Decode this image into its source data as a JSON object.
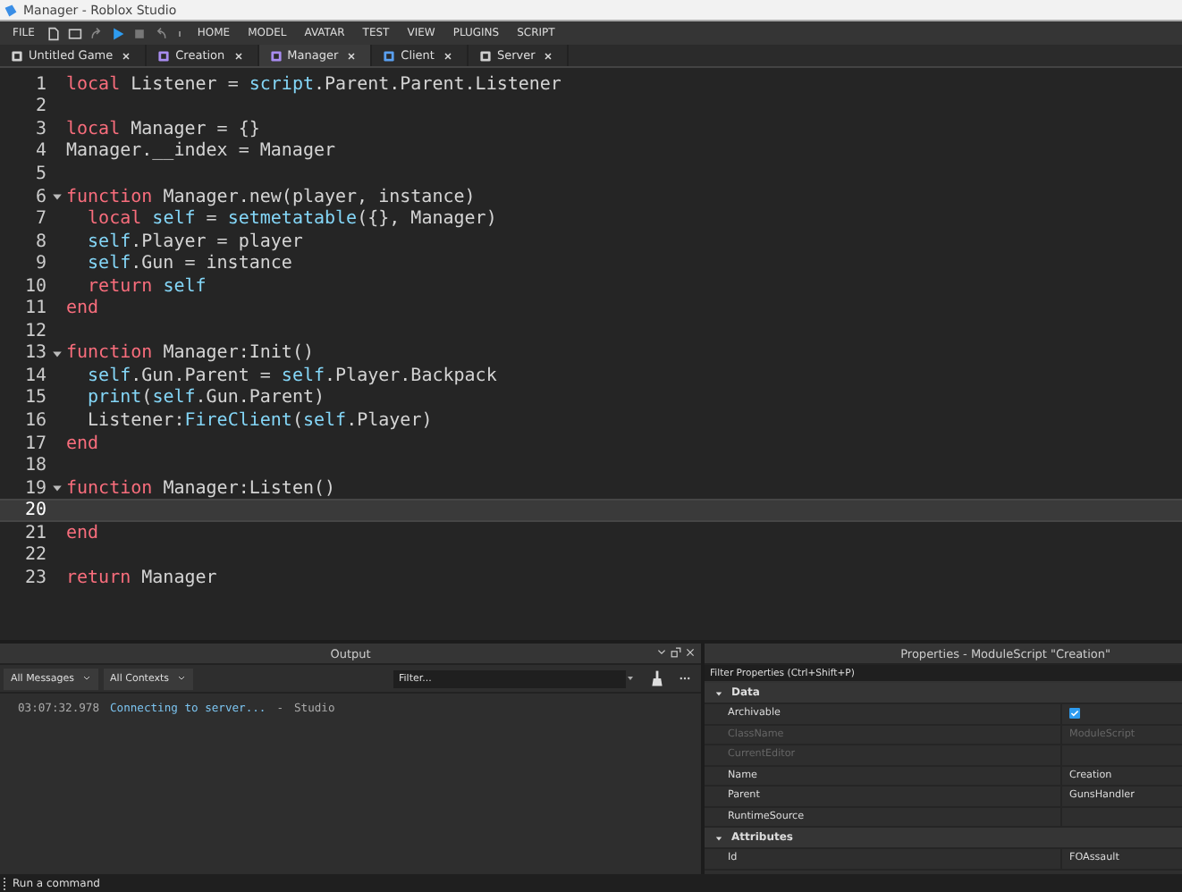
{
  "window": {
    "title": "Manager - Roblox Studio"
  },
  "menu": {
    "file": "FILE",
    "items": [
      "HOME",
      "MODEL",
      "AVATAR",
      "TEST",
      "VIEW",
      "PLUGINS",
      "SCRIPT"
    ]
  },
  "tabs": [
    {
      "label": "Untitled Game",
      "selected": false,
      "kind": "place"
    },
    {
      "label": "Creation",
      "selected": false,
      "kind": "module"
    },
    {
      "label": "Manager",
      "selected": true,
      "kind": "module"
    },
    {
      "label": "Client",
      "selected": false,
      "kind": "local"
    },
    {
      "label": "Server",
      "selected": false,
      "kind": "server"
    }
  ],
  "editor": {
    "lines": [
      {
        "number": "1",
        "foldable": false,
        "selected": false,
        "tokens": [
          {
            "text": "local",
            "kind": "keyword"
          },
          {
            "text": " Listener = ",
            "kind": "plain"
          },
          {
            "text": "script",
            "kind": "builtin"
          },
          {
            "text": ".Parent.Parent.Listener",
            "kind": "plain"
          }
        ]
      },
      {
        "number": "2",
        "foldable": false,
        "selected": false
      },
      {
        "number": "3",
        "foldable": false,
        "selected": false,
        "tokens": [
          {
            "text": "local",
            "kind": "keyword"
          },
          {
            "text": " Manager = {}",
            "kind": "plain"
          }
        ]
      },
      {
        "number": "4",
        "foldable": false,
        "selected": false,
        "tokens": [
          {
            "text": "Manager.__index = Manager",
            "kind": "plain"
          }
        ]
      },
      {
        "number": "5",
        "foldable": false,
        "selected": false
      },
      {
        "number": "6",
        "foldable": true,
        "selected": false,
        "tokens": [
          {
            "text": "function",
            "kind": "keyword"
          },
          {
            "text": " Manager.new(player, instance)",
            "kind": "plain"
          }
        ]
      },
      {
        "number": "7",
        "foldable": false,
        "selected": false,
        "tokens": [
          {
            "text": "  local",
            "kind": "keyword"
          },
          {
            "text": " self",
            "kind": "builtin"
          },
          {
            "text": " = ",
            "kind": "plain"
          },
          {
            "text": "setmetatable",
            "kind": "builtin"
          },
          {
            "text": "({}, Manager)",
            "kind": "plain"
          }
        ]
      },
      {
        "number": "8",
        "foldable": false,
        "selected": false,
        "tokens": [
          {
            "text": "  self",
            "kind": "builtin"
          },
          {
            "text": ".Player = player",
            "kind": "plain"
          }
        ]
      },
      {
        "number": "9",
        "foldable": false,
        "selected": false,
        "tokens": [
          {
            "text": "  self",
            "kind": "builtin"
          },
          {
            "text": ".Gun = instance",
            "kind": "plain"
          }
        ]
      },
      {
        "number": "10",
        "foldable": false,
        "selected": false,
        "tokens": [
          {
            "text": "  return",
            "kind": "keyword"
          },
          {
            "text": " self",
            "kind": "builtin"
          }
        ]
      },
      {
        "number": "11",
        "foldable": false,
        "selected": false,
        "tokens": [
          {
            "text": "end",
            "kind": "keyword"
          }
        ]
      },
      {
        "number": "12",
        "foldable": false,
        "selected": false
      },
      {
        "number": "13",
        "foldable": true,
        "selected": false,
        "tokens": [
          {
            "text": "function",
            "kind": "keyword"
          },
          {
            "text": " Manager:Init()",
            "kind": "plain"
          }
        ]
      },
      {
        "number": "14",
        "foldable": false,
        "selected": false,
        "tokens": [
          {
            "text": "  self",
            "kind": "builtin"
          },
          {
            "text": ".Gun.Parent = ",
            "kind": "plain"
          },
          {
            "text": "self",
            "kind": "builtin"
          },
          {
            "text": ".Player.Backpack",
            "kind": "plain"
          }
        ]
      },
      {
        "number": "15",
        "foldable": false,
        "selected": false,
        "tokens": [
          {
            "text": "  print",
            "kind": "builtin"
          },
          {
            "text": "(",
            "kind": "plain"
          },
          {
            "text": "self",
            "kind": "builtin"
          },
          {
            "text": ".Gun.Parent)",
            "kind": "plain"
          }
        ]
      },
      {
        "number": "16",
        "foldable": false,
        "selected": false,
        "tokens": [
          {
            "text": "  Listener:",
            "kind": "plain"
          },
          {
            "text": "FireClient",
            "kind": "builtin"
          },
          {
            "text": "(",
            "kind": "plain"
          },
          {
            "text": "self",
            "kind": "builtin"
          },
          {
            "text": ".Player)",
            "kind": "plain"
          }
        ]
      },
      {
        "number": "17",
        "foldable": false,
        "selected": false,
        "tokens": [
          {
            "text": "end",
            "kind": "keyword"
          }
        ]
      },
      {
        "number": "18",
        "foldable": false,
        "selected": false
      },
      {
        "number": "19",
        "foldable": true,
        "selected": false,
        "tokens": [
          {
            "text": "function",
            "kind": "keyword"
          },
          {
            "text": " Manager:Listen()",
            "kind": "plain"
          }
        ]
      },
      {
        "number": "20",
        "foldable": false,
        "selected": true
      },
      {
        "number": "21",
        "foldable": false,
        "selected": false,
        "tokens": [
          {
            "text": "end",
            "kind": "keyword"
          }
        ]
      },
      {
        "number": "22",
        "foldable": false,
        "selected": false
      },
      {
        "number": "23",
        "foldable": false,
        "selected": false,
        "tokens": [
          {
            "text": "return",
            "kind": "keyword"
          },
          {
            "text": " Manager",
            "kind": "plain"
          }
        ]
      }
    ]
  },
  "output": {
    "title": "Output",
    "filters": [
      "All Messages",
      "All Contexts"
    ],
    "search": {
      "placeholder": "Filter..."
    },
    "entries": [
      {
        "time": "03:07:32.978",
        "message": "Connecting to server...",
        "separator": "-",
        "source": "Studio"
      }
    ]
  },
  "properties": {
    "title": "Properties - ModuleScript \"Creation\"",
    "search": {
      "placeholder": "Filter Properties (Ctrl+Shift+P)"
    },
    "sections": [
      {
        "name": "Data",
        "expanded": true,
        "rows": [
          {
            "name": "Archivable",
            "kind": "checkbox",
            "checked": true,
            "disabled": false
          },
          {
            "name": "ClassName",
            "kind": "text",
            "value": "ModuleScript",
            "disabled": true
          },
          {
            "name": "CurrentEditor",
            "kind": "text",
            "disabled": true
          },
          {
            "name": "Name",
            "kind": "text",
            "value": "Creation",
            "disabled": false
          },
          {
            "name": "Parent",
            "kind": "text",
            "value": "GunsHandler",
            "disabled": false
          },
          {
            "name": "RuntimeSource",
            "kind": "text",
            "disabled": false
          }
        ]
      },
      {
        "name": "Attributes",
        "expanded": true,
        "rows": [
          {
            "name": "Id",
            "kind": "text",
            "value": "FOAssault",
            "disabled": false
          }
        ]
      }
    ]
  },
  "command_bar": {
    "placeholder": "Run a command"
  }
}
